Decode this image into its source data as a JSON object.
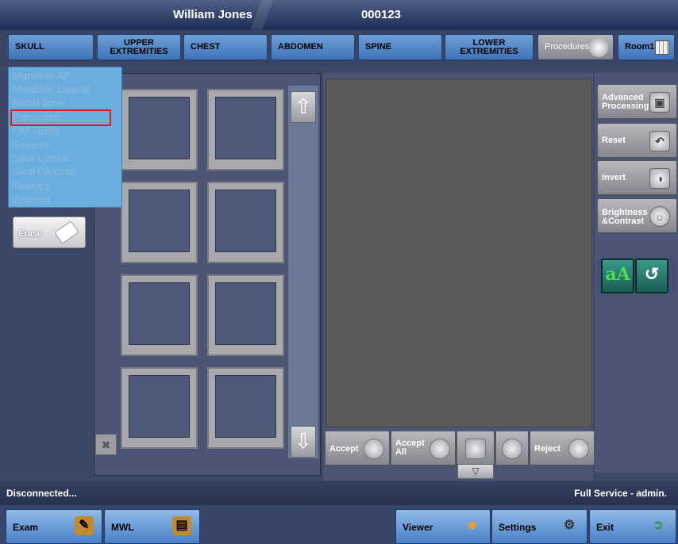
{
  "header": {
    "patient_name": "William Jones",
    "patient_id": "000123"
  },
  "categories": [
    {
      "label": "SKULL"
    },
    {
      "label": "UPPER EXTREMITIES"
    },
    {
      "label": "CHEST"
    },
    {
      "label": "ABDOMEN"
    },
    {
      "label": "SPINE"
    },
    {
      "label": "LOWER EXTREMITIES"
    },
    {
      "label": "Procedures"
    },
    {
      "label": "Room1"
    }
  ],
  "dropdown": {
    "items": [
      "Mandible AP",
      "Mandible Lateral",
      "Nasal bone",
      "Panoramic",
      "PATTERN",
      "Sinuses",
      "Skull Lateral",
      "Skull PA/Orbit",
      "Towne's",
      "Zygoma"
    ],
    "highlighted": "Panoramic"
  },
  "left_tools": {
    "erase_label": "Erase",
    "clear_icon": "close-icon"
  },
  "viewer_buttons": {
    "accept": "Accept",
    "accept_all": "Accept All",
    "reject": "Reject"
  },
  "tools": {
    "advanced": "Advanced Processing",
    "reset": "Reset",
    "invert": "Invert",
    "brightness": "Brightness &Contrast"
  },
  "status": {
    "left": "Disconnected...",
    "right": "Full Service - admin."
  },
  "bottom": {
    "exam": "Exam",
    "mwl": "MWL",
    "viewer": "Viewer",
    "settings": "Settings",
    "exit": "Exit"
  },
  "colors": {
    "accent": "#4a80c6",
    "highlight": "#e01a1a",
    "panel": "#4d5575"
  }
}
